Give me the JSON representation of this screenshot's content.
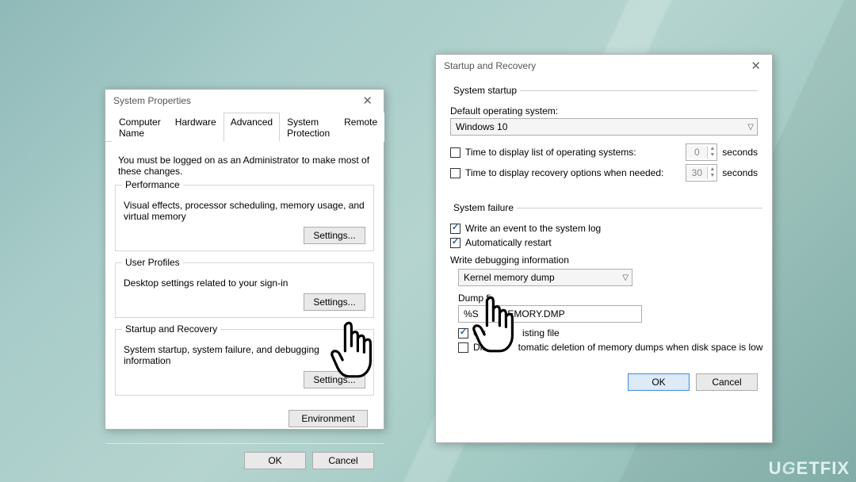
{
  "sysprops": {
    "title": "System Properties",
    "tabs": [
      "Computer Name",
      "Hardware",
      "Advanced",
      "System Protection",
      "Remote"
    ],
    "note": "You must be logged on as an Administrator to make most of these changes.",
    "perf": {
      "legend": "Performance",
      "desc": "Visual effects, processor scheduling, memory usage, and virtual memory",
      "btn": "Settings..."
    },
    "prof": {
      "legend": "User Profiles",
      "desc": "Desktop settings related to your sign-in",
      "btn": "Settings..."
    },
    "startup": {
      "legend": "Startup and Recovery",
      "desc": "System startup, system failure, and debugging information",
      "btn": "Settings..."
    },
    "env_btn_partial": "Environment",
    "ok": "OK",
    "cancel": "Cancel"
  },
  "recovery": {
    "title": "Startup and Recovery",
    "startup_legend": "System startup",
    "default_os_label": "Default operating system:",
    "default_os_value": "Windows 10",
    "time_list_label": "Time to display list of operating systems:",
    "time_list_value": "0",
    "time_recovery_label": "Time to display recovery options when needed:",
    "time_recovery_value": "30",
    "seconds": "seconds",
    "failure_legend": "System failure",
    "write_event": "Write an event to the system log",
    "auto_restart": "Automatically restart",
    "writedbg_label": "Write debugging information",
    "dump_type": "Kernel memory dump",
    "dump_file_label_partial": "Dump fi",
    "dump_file_value_partial": "%S           EMORY.DMP",
    "overwrite_partial": "Ov              isting file",
    "disable_auto_del": "Disabl       tomatic deletion of memory dumps when disk space is low",
    "ok": "OK",
    "cancel": "Cancel"
  },
  "watermark": "UGETFIX"
}
